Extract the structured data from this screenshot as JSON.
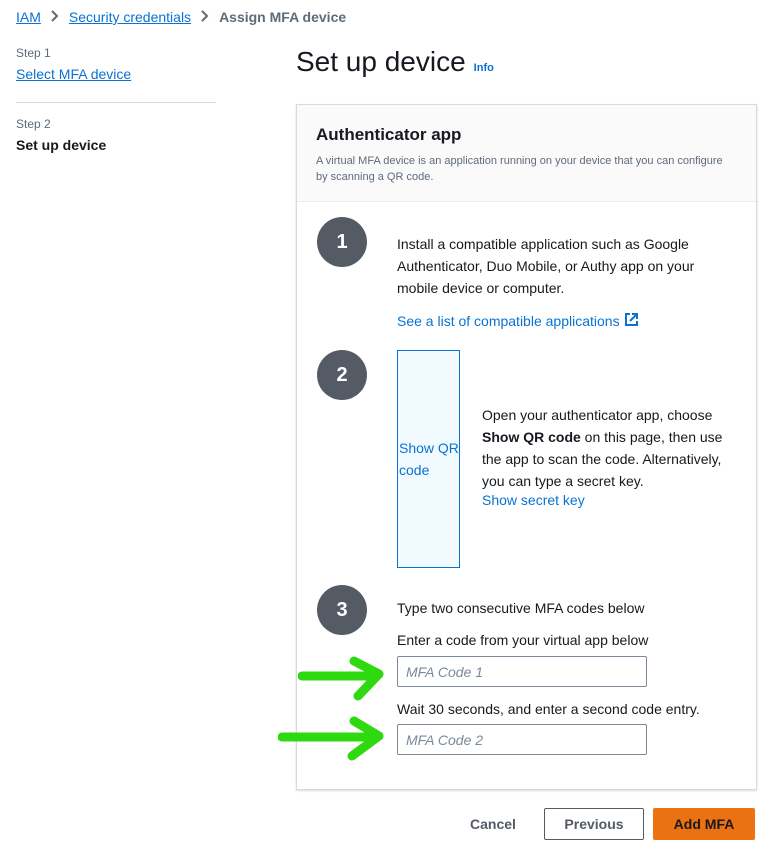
{
  "breadcrumb": {
    "items": [
      "IAM",
      "Security credentials"
    ],
    "current": "Assign MFA device"
  },
  "steps": [
    {
      "number": "Step 1",
      "label": "Select MFA device"
    },
    {
      "number": "Step 2",
      "label": "Set up device"
    }
  ],
  "page": {
    "title": "Set up device",
    "info": "Info"
  },
  "panel": {
    "title": "Authenticator app",
    "description": "A virtual MFA device is an application running on your device that you can configure by scanning a QR code."
  },
  "step_1": {
    "number": "1",
    "text": "Install a compatible application such as Google Authenticator, Duo Mobile, or Authy app on your mobile device or computer.",
    "link": "See a list of compatible applications"
  },
  "step_2": {
    "number": "2",
    "qr_button": "Show QR code",
    "text_before": "Open your authenticator app, choose ",
    "text_bold": "Show QR code",
    "text_after": " on this page, then use the app to scan the code. Alternatively, you can type a secret key.",
    "secret_link": "Show secret key"
  },
  "step_3": {
    "number": "3",
    "title": "Type two consecutive MFA codes below",
    "code1_label": "Enter a code from your virtual app below",
    "code1_placeholder": "MFA Code 1",
    "code1_value": "",
    "code2_label": "Wait 30 seconds, and enter a second code entry.",
    "code2_placeholder": "MFA Code 2",
    "code2_value": ""
  },
  "footer": {
    "cancel": "Cancel",
    "previous": "Previous",
    "add": "Add MFA"
  },
  "colors": {
    "link": "#0972d3",
    "primary": "#ec7211",
    "annotation_arrow": "#2fd90f"
  },
  "icons": {
    "breadcrumb_separator": "chevron-right-icon",
    "external_link": "external-link-icon",
    "annotation": "arrow-right-icon"
  }
}
